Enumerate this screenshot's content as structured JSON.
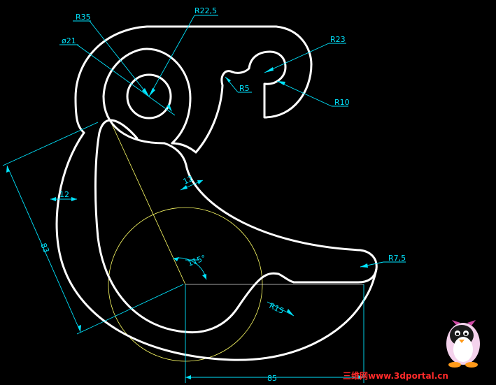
{
  "drawing": {
    "dimensions": {
      "r35": "R35",
      "r22_5": "R22,5",
      "d21": "ø21",
      "r23": "R23",
      "r5": "R5",
      "r10": "R10",
      "w12_left": "12",
      "w12_right": "12",
      "l83": "83",
      "a115": "115°",
      "r7_5": "R7,5",
      "r15": "R15",
      "l85": "85"
    },
    "colors": {
      "background": "#000000",
      "outline": "#ffffff",
      "dimension": "#00e5ff",
      "construction": "#ffff66"
    }
  },
  "watermark": {
    "text": "三维网www.3dportal.cn"
  },
  "mascot": {
    "icon": "penguin-mascot-icon"
  }
}
